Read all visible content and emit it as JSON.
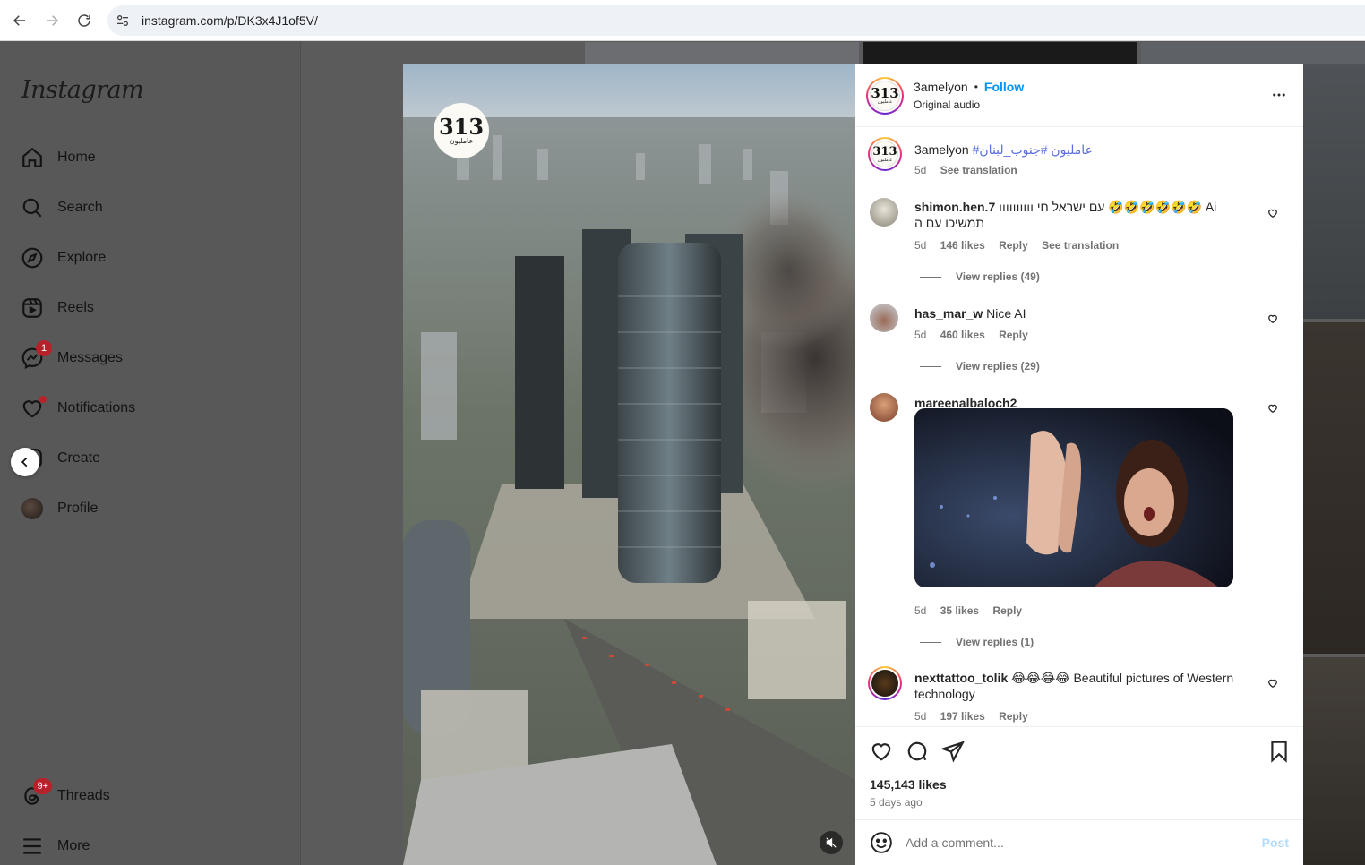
{
  "browser": {
    "url": "instagram.com/p/DK3x4J1of5V/"
  },
  "sidebar": {
    "logo": "Instagram",
    "items": [
      {
        "label": "Home",
        "icon": "home-icon"
      },
      {
        "label": "Search",
        "icon": "search-icon"
      },
      {
        "label": "Explore",
        "icon": "compass-icon"
      },
      {
        "label": "Reels",
        "icon": "reels-icon"
      },
      {
        "label": "Messages",
        "icon": "messenger-icon",
        "badge": "1"
      },
      {
        "label": "Notifications",
        "icon": "heart-icon"
      },
      {
        "label": "Create",
        "icon": "plus-square-icon"
      },
      {
        "label": "Profile",
        "icon": "avatar"
      },
      {
        "label": "Threads",
        "icon": "threads-icon",
        "badge": "9+"
      },
      {
        "label": "More",
        "icon": "hamburger-icon"
      }
    ]
  },
  "media": {
    "stamp_number": "313",
    "stamp_sub": "عامليون"
  },
  "post": {
    "author": "3amelyon",
    "separator": "•",
    "follow_label": "Follow",
    "audio": "Original audio",
    "avatar_number": "313",
    "avatar_sub": "عامليون",
    "caption": {
      "user": "3amelyon",
      "text": "#عامليون #جنوب_لبنان",
      "time": "5d",
      "see_translation": "See translation"
    },
    "comments": [
      {
        "user": "shimon.hen.7",
        "text": "ıııııııııı עם ישראל חי 🤣🤣🤣🤣🤣🤣 Ai תמשיכו עם ה",
        "time": "5d",
        "likes": "146 likes",
        "reply": "Reply",
        "see_translation": "See translation",
        "view_replies": "View replies (49)"
      },
      {
        "user": "has_mar_w",
        "text": "Nice AI",
        "time": "5d",
        "likes": "460 likes",
        "reply": "Reply",
        "view_replies": "View replies (29)"
      },
      {
        "user": "mareenalbaloch2",
        "text": "",
        "time": "5d",
        "likes": "35 likes",
        "reply": "Reply",
        "view_replies": "View replies (1)"
      },
      {
        "user": "nexttattoo_tolik",
        "text": "😂😂😂😂 Beautiful pictures of Western technology",
        "time": "5d",
        "likes": "197 likes",
        "reply": "Reply"
      }
    ],
    "likes_total": "145,143 likes",
    "posted_ago": "5 days ago",
    "comment_placeholder": "Add a comment...",
    "post_label": "Post"
  },
  "colors": {
    "link_blue": "#0095f6",
    "badge_red": "#b8212a",
    "post_disabled": "#b3dbff"
  }
}
